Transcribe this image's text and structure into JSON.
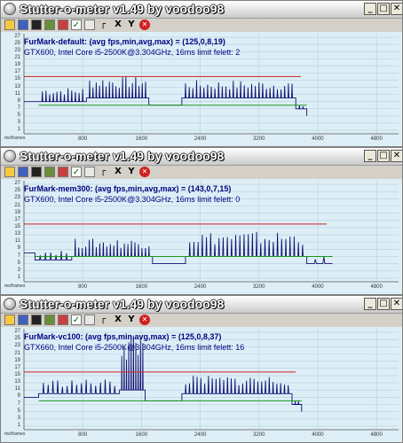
{
  "windows": [
    {
      "title": "Stutter-o-meter v1.49 by voodoo98",
      "info_line1": "FurMark-default: (avg fps,min,avg,max) = (125,0,8,19)",
      "info_line2": "GTX600,  Intel Core i5-2500K@3.304GHz, 16ms limit felett: 2",
      "y_ticks": [
        "27",
        "25",
        "23",
        "21",
        "19",
        "17",
        "15",
        "13",
        "11",
        "9",
        "7",
        "5",
        "3",
        "1"
      ],
      "x_ticks": [
        "800",
        "1600",
        "2400",
        "3200",
        "4000",
        "4800"
      ],
      "unit_label": "ms/frames",
      "toolbar_x": "X",
      "toolbar_y": "Y",
      "window_buttons": {
        "minimize": "_",
        "maximize": "□",
        "close": "✕"
      },
      "chart_data": {
        "type": "line",
        "xlabel": "ms/frames",
        "ylabel": "",
        "xlim": [
          0,
          5100
        ],
        "ylim": [
          0,
          28
        ],
        "limit_line": 16,
        "avg_line": 8,
        "segments": [
          {
            "x0": 0,
            "x1": 200,
            "base": 9,
            "spikes": 0,
            "peak": 9
          },
          {
            "x0": 200,
            "x1": 850,
            "base": 9,
            "spikes": 12,
            "peak": 13
          },
          {
            "x0": 850,
            "x1": 1700,
            "base": 10,
            "spikes": 18,
            "peak": 16
          },
          {
            "x0": 1700,
            "x1": 2150,
            "base": 8,
            "spikes": 0,
            "peak": 8
          },
          {
            "x0": 2150,
            "x1": 3700,
            "base": 10,
            "spikes": 30,
            "peak": 15
          },
          {
            "x0": 3700,
            "x1": 3850,
            "base": 7,
            "spikes": 2,
            "peak": 8
          }
        ],
        "end_x": 3850
      }
    },
    {
      "title": "Stutter-o-meter v1.49 by voodoo98",
      "info_line1": "FurMark-mem300: (avg fps,min,avg,max) = (143,0,7,15)",
      "info_line2": "GTX600,  Intel Core i5-2500K@3.304GHz, 16ms limit felett: 0",
      "y_ticks": [
        "27",
        "25",
        "23",
        "21",
        "19",
        "17",
        "15",
        "13",
        "11",
        "9",
        "7",
        "5",
        "3",
        "1"
      ],
      "x_ticks": [
        "800",
        "1600",
        "2400",
        "3200",
        "4000",
        "4800"
      ],
      "unit_label": "ms/frames",
      "toolbar_x": "X",
      "toolbar_y": "Y",
      "window_buttons": {
        "minimize": "_",
        "maximize": "□",
        "close": "✕"
      },
      "chart_data": {
        "type": "line",
        "xlabel": "ms/frames",
        "ylabel": "",
        "xlim": [
          0,
          5100
        ],
        "ylim": [
          0,
          28
        ],
        "limit_line": 16,
        "avg_line": 7,
        "segments": [
          {
            "x0": 0,
            "x1": 150,
            "base": 8,
            "spikes": 0,
            "peak": 8
          },
          {
            "x0": 150,
            "x1": 650,
            "base": 6,
            "spikes": 6,
            "peak": 9
          },
          {
            "x0": 650,
            "x1": 1750,
            "base": 7,
            "spikes": 22,
            "peak": 12
          },
          {
            "x0": 1750,
            "x1": 2200,
            "base": 5,
            "spikes": 0,
            "peak": 5
          },
          {
            "x0": 2200,
            "x1": 3850,
            "base": 7,
            "spikes": 28,
            "peak": 14
          },
          {
            "x0": 3850,
            "x1": 4200,
            "base": 5,
            "spikes": 2,
            "peak": 7
          }
        ],
        "end_x": 4200
      }
    },
    {
      "title": "Stutter-o-meter v1.49 by voodoo98",
      "info_line1": "FurMark-vc100: (avg fps,min,avg,max) = (125,0,8,37)",
      "info_line2": "GTX660,  Intel Core i5-2500K@3.304GHz, 16ms limit felett: 16",
      "y_ticks": [
        "27",
        "25",
        "23",
        "21",
        "19",
        "17",
        "15",
        "13",
        "11",
        "9",
        "7",
        "5",
        "3",
        "1"
      ],
      "x_ticks": [
        "800",
        "1600",
        "2400",
        "3200",
        "4000",
        "4800"
      ],
      "unit_label": "ms/frames",
      "toolbar_x": "X",
      "toolbar_y": "Y",
      "window_buttons": {
        "minimize": "_",
        "maximize": "□",
        "close": "✕"
      },
      "chart_data": {
        "type": "line",
        "xlabel": "ms/frames",
        "ylabel": "",
        "xlim": [
          0,
          5100
        ],
        "ylim": [
          0,
          28
        ],
        "limit_line": 16,
        "avg_line": 8,
        "segments": [
          {
            "x0": 0,
            "x1": 200,
            "base": 9,
            "spikes": 0,
            "peak": 9
          },
          {
            "x0": 200,
            "x1": 1300,
            "base": 10,
            "spikes": 16,
            "peak": 14
          },
          {
            "x0": 1300,
            "x1": 1650,
            "base": 11,
            "spikes": 10,
            "peak": 28
          },
          {
            "x0": 1650,
            "x1": 2150,
            "base": 8,
            "spikes": 0,
            "peak": 8
          },
          {
            "x0": 2150,
            "x1": 3650,
            "base": 10,
            "spikes": 28,
            "peak": 15
          },
          {
            "x0": 3650,
            "x1": 3780,
            "base": 7,
            "spikes": 2,
            "peak": 8
          }
        ],
        "end_x": 3780
      }
    }
  ]
}
